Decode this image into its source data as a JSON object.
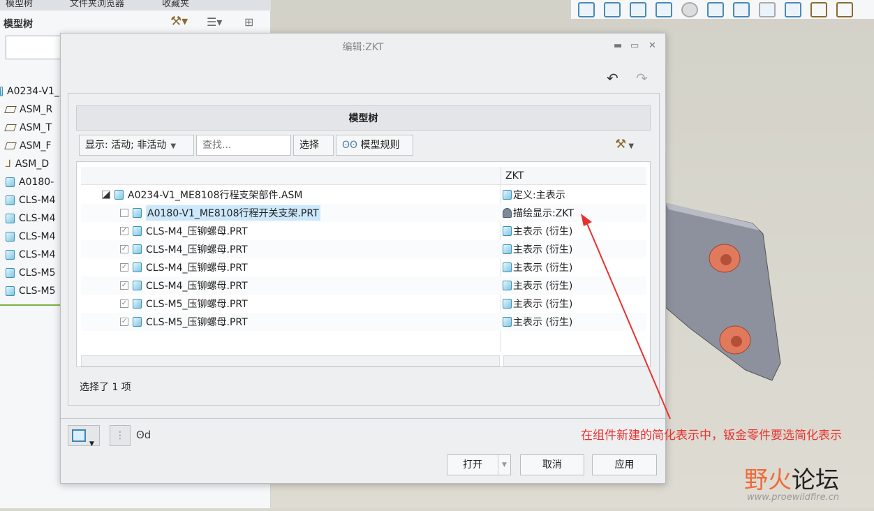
{
  "left_panel": {
    "tabs": [
      "模型树",
      "文件夹浏览器",
      "收藏夹"
    ],
    "title": "模型树",
    "items": [
      {
        "label": "A0234-V1_",
        "icon": "assembly-icon"
      },
      {
        "label": "ASM_R",
        "icon": "plane-icon"
      },
      {
        "label": "ASM_T",
        "icon": "plane-icon"
      },
      {
        "label": "ASM_F",
        "icon": "plane-icon"
      },
      {
        "label": "ASM_D",
        "icon": "csys-icon"
      },
      {
        "label": "A0180-",
        "icon": "part-icon"
      },
      {
        "label": "CLS-M4",
        "icon": "part-icon"
      },
      {
        "label": "CLS-M4",
        "icon": "part-icon"
      },
      {
        "label": "CLS-M4",
        "icon": "part-icon"
      },
      {
        "label": "CLS-M4",
        "icon": "part-icon"
      },
      {
        "label": "CLS-M5",
        "icon": "part-icon"
      },
      {
        "label": "CLS-M5",
        "icon": "part-icon"
      }
    ]
  },
  "dialog": {
    "title": "编辑:ZKT",
    "panel_title": "模型树",
    "toolbar": {
      "display": "显示: 活动; 非活动",
      "search_placeholder": "查找...",
      "select": "选择",
      "rules": "模型规则"
    },
    "column_header": "ZKT",
    "rows": [
      {
        "name": "A0234-V1_ME8108行程支架部件.ASM",
        "state": "定义:主表示",
        "checked": "partial",
        "level": 0
      },
      {
        "name": "A0180-V1_ME8108行程开关支架.PRT",
        "state": "描绘显示:ZKT",
        "checked": false,
        "level": 1,
        "selected": true
      },
      {
        "name": "CLS-M4_压铆螺母.PRT",
        "state": "主表示 (衍生)",
        "checked": true,
        "level": 1
      },
      {
        "name": "CLS-M4_压铆螺母.PRT",
        "state": "主表示 (衍生)",
        "checked": true,
        "level": 1
      },
      {
        "name": "CLS-M4_压铆螺母.PRT",
        "state": "主表示 (衍生)",
        "checked": true,
        "level": 1
      },
      {
        "name": "CLS-M4_压铆螺母.PRT",
        "state": "主表示 (衍生)",
        "checked": true,
        "level": 1
      },
      {
        "name": "CLS-M5_压铆螺母.PRT",
        "state": "主表示 (衍生)",
        "checked": true,
        "level": 1
      },
      {
        "name": "CLS-M5_压铆螺母.PRT",
        "state": "主表示 (衍生)",
        "checked": true,
        "level": 1
      }
    ],
    "status": "选择了 1 项",
    "buttons": {
      "open": "打开",
      "cancel": "取消",
      "apply": "应用"
    }
  },
  "annotation": "在组件新建的简化表示中，钣金零件要选简化表示",
  "watermark": {
    "logo": "野火论坛",
    "url": "www.proewildfire.cn"
  },
  "colors": {
    "selection": "#cce8fb",
    "annotation": "#e8312f"
  }
}
